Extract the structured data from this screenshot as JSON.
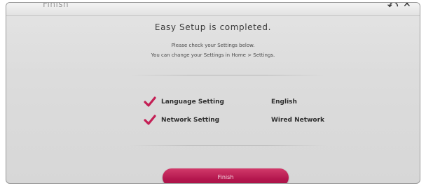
{
  "window": {
    "tab_title": "Finish",
    "back_glyph": "⤺",
    "close_glyph": "✕"
  },
  "dialog": {
    "heading": "Easy Setup is completed.",
    "instruction_line1": "Please check your Settings below.",
    "instruction_line2": "You can change your Settings in Home > Settings."
  },
  "settings": [
    {
      "label": "Language Setting",
      "value": "English",
      "icon": "checkmark-icon"
    },
    {
      "label": "Network Setting",
      "value": "Wired Network",
      "icon": "checkmark-icon"
    }
  ],
  "actions": {
    "finish_label": "Finish"
  },
  "colors": {
    "accent": "#b3164d",
    "checkmark": "#c41f55",
    "panel_bg": "#dcdcdc"
  }
}
